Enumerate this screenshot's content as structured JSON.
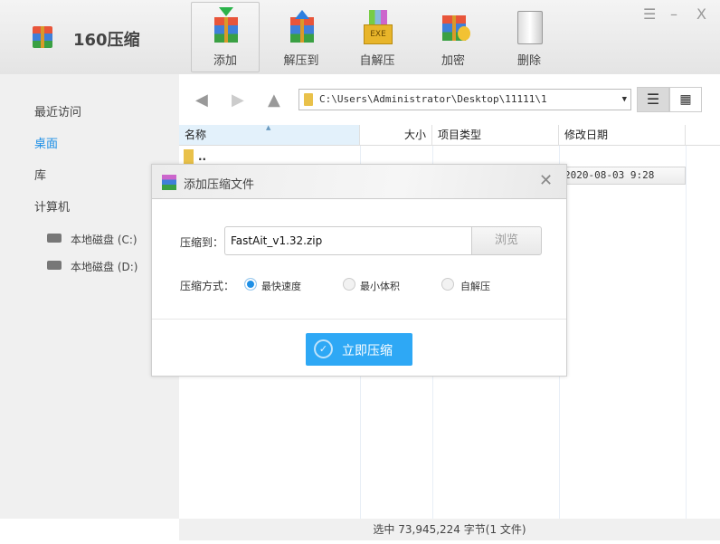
{
  "app": {
    "title": "160压缩"
  },
  "toolbar": [
    {
      "label": "添加",
      "icon": "add-archive-icon"
    },
    {
      "label": "解压到",
      "icon": "extract-icon"
    },
    {
      "label": "自解压",
      "icon": "sfx-exe-icon",
      "badge": "EXE"
    },
    {
      "label": "加密",
      "icon": "encrypt-icon"
    },
    {
      "label": "删除",
      "icon": "trash-icon"
    }
  ],
  "window": {
    "menu": "☰",
    "minimize": "–",
    "close": "X"
  },
  "sidebar": {
    "items": [
      {
        "label": "最近访问"
      },
      {
        "label": "桌面"
      },
      {
        "label": "库"
      },
      {
        "label": "计算机"
      }
    ],
    "disks": [
      {
        "label": "本地磁盘 (C:)"
      },
      {
        "label": "本地磁盘 (D:)"
      }
    ]
  },
  "nav": {
    "path": "C:\\Users\\Administrator\\Desktop\\11111\\1"
  },
  "columns": [
    "名称",
    "大小",
    "项目类型",
    "修改日期"
  ],
  "rows": [
    {
      "name": "..",
      "date": ""
    },
    {
      "name": "",
      "date": "2020-08-03 9:28"
    }
  ],
  "status": "选中  73,945,224 字节(1 文件)",
  "dialog": {
    "title": "添加压缩文件",
    "target_label": "压缩到：",
    "target_value": "FastAit_v1.32.zip",
    "browse": "浏览",
    "mode_label": "压缩方式：",
    "modes": [
      "最快速度",
      "最小体积",
      "自解压"
    ],
    "submit": "立即压缩"
  },
  "colors": {
    "accent": "#2ea8f5",
    "link": "#1e8fe6"
  }
}
